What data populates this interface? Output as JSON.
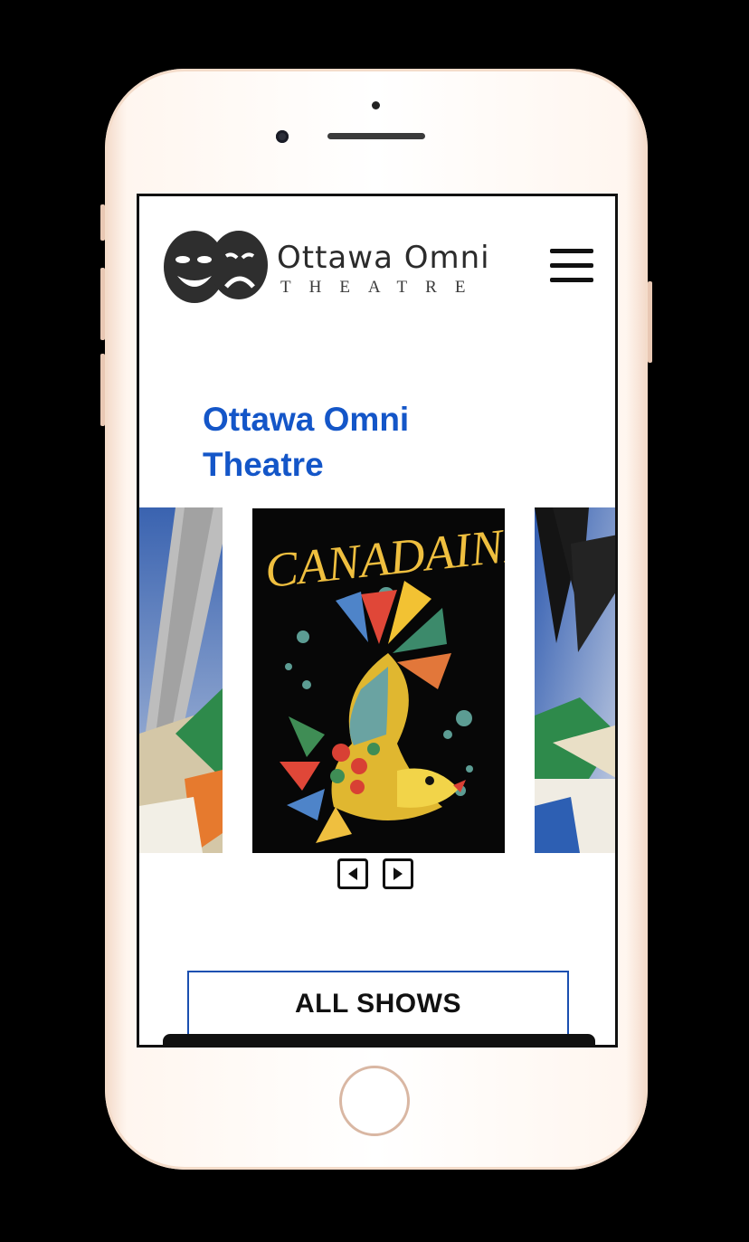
{
  "header": {
    "logo_wordmark": "Ottawa Omni",
    "logo_subtitle": "THEATRE",
    "menu_icon": "hamburger-menu-icon"
  },
  "main": {
    "title": "Ottawa Omni Theatre",
    "carousel": {
      "slides": [
        {
          "position": "previous",
          "artwork": "tropical-palm-poster"
        },
        {
          "position": "current",
          "artwork": "canadaink-fish-poster",
          "poster_text": "CANADAINK"
        },
        {
          "position": "next",
          "artwork": "palm-frond-poster"
        }
      ],
      "prev_icon": "chevron-left-icon",
      "next_icon": "chevron-right-icon"
    },
    "all_shows_label": "ALL SHOWS"
  },
  "colors": {
    "accent": "#1456c8",
    "button_border": "#1a4fb0",
    "device_frame": "#f3d9c8",
    "background": "#000000"
  }
}
